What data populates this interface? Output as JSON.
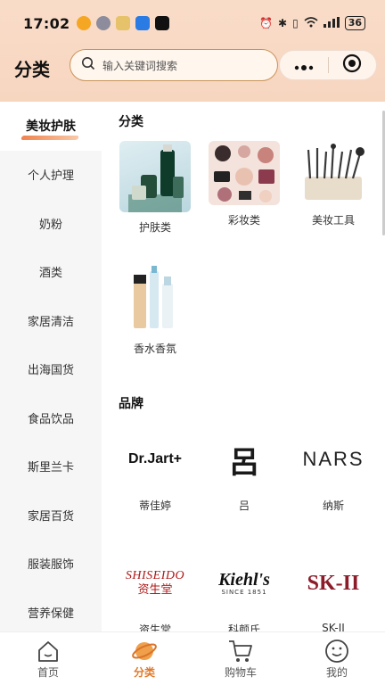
{
  "status": {
    "time": "17:02",
    "battery": "36"
  },
  "header": {
    "title": "分类",
    "search_placeholder": "输入关键词搜索"
  },
  "sidebar": {
    "items": [
      {
        "label": "美妆护肤",
        "active": true
      },
      {
        "label": "个人护理"
      },
      {
        "label": "奶粉"
      },
      {
        "label": "酒类"
      },
      {
        "label": "家居清洁"
      },
      {
        "label": "出海国货"
      },
      {
        "label": "食品饮品"
      },
      {
        "label": "斯里兰卡"
      },
      {
        "label": "家居百货"
      },
      {
        "label": "服装服饰"
      },
      {
        "label": "营养保健"
      }
    ]
  },
  "categories": {
    "title": "分类",
    "items": [
      {
        "label": "护肤类"
      },
      {
        "label": "彩妆类"
      },
      {
        "label": "美妆工具"
      },
      {
        "label": "香水香氛"
      }
    ]
  },
  "brands": {
    "title": "品牌",
    "items": [
      {
        "label": "蒂佳婷",
        "logo": "Dr.Jart+"
      },
      {
        "label": "吕",
        "logo": "呂"
      },
      {
        "label": "纳斯",
        "logo": "NARS"
      },
      {
        "label": "资生堂",
        "logo": "SHISEIDO",
        "logo_sub": "资生堂"
      },
      {
        "label": "科颜氏",
        "logo": "Kiehl's",
        "logo_sub": "SINCE 1851"
      },
      {
        "label": "SK-II",
        "logo": "SK-II"
      }
    ]
  },
  "tabbar": {
    "items": [
      {
        "label": "首页"
      },
      {
        "label": "分类",
        "active": true
      },
      {
        "label": "购物车"
      },
      {
        "label": "我的"
      }
    ]
  },
  "colors": {
    "accent": "#e07a2a",
    "header_bg": "#f8d9c4"
  }
}
